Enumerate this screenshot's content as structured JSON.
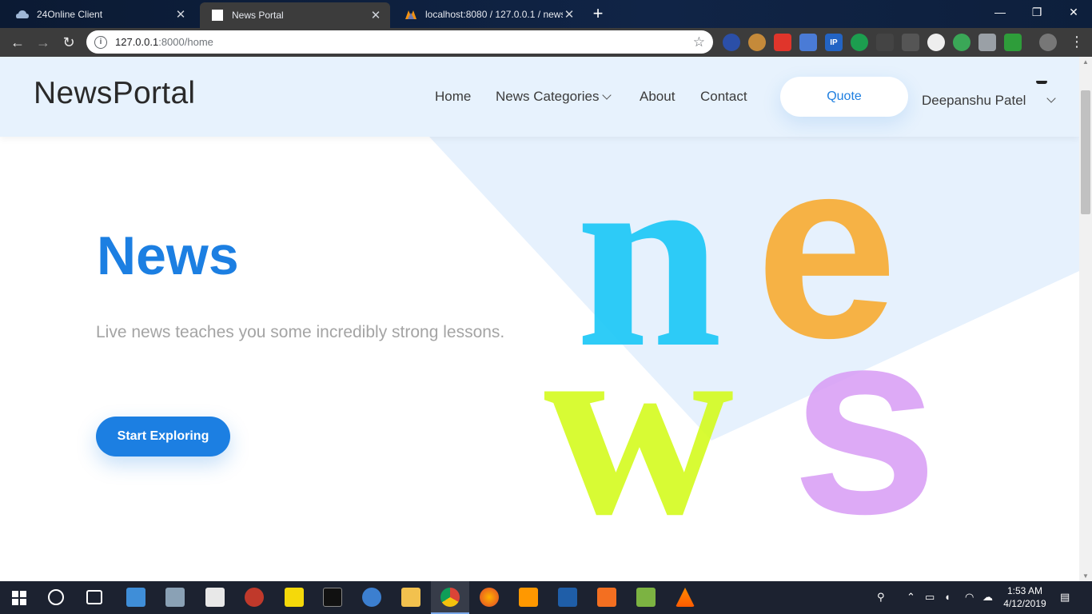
{
  "browser": {
    "tabs": [
      {
        "title": "24Online Client",
        "active": false
      },
      {
        "title": "News Portal",
        "active": true
      },
      {
        "title": "localhost:8080 / 127.0.0.1 / news",
        "active": false
      }
    ],
    "new_tab_label": "+",
    "url_host": "127.0.0.1",
    "url_rest": ":8000/home"
  },
  "site": {
    "brand": "NewsPortal",
    "nav": {
      "home": "Home",
      "categories": "News Categories",
      "about": "About",
      "contact": "Contact"
    },
    "quote_button": "Quote",
    "user_name": "Deepanshu Patel"
  },
  "hero": {
    "title": "News",
    "subtitle": "Live news teaches you some incredibly strong lessons.",
    "cta": "Start Exploring",
    "art_letters": [
      "n",
      "e",
      "w",
      "s"
    ]
  },
  "colors": {
    "accent": "#1c7fe2",
    "header_bg": "#e7f2fd",
    "letter_n": "#1ec8f7",
    "letter_e": "#f9a826",
    "letter_w": "#d4fb1f",
    "letter_s": "#d89cf5"
  },
  "taskbar": {
    "time": "1:53 AM",
    "date": "4/12/2019"
  }
}
